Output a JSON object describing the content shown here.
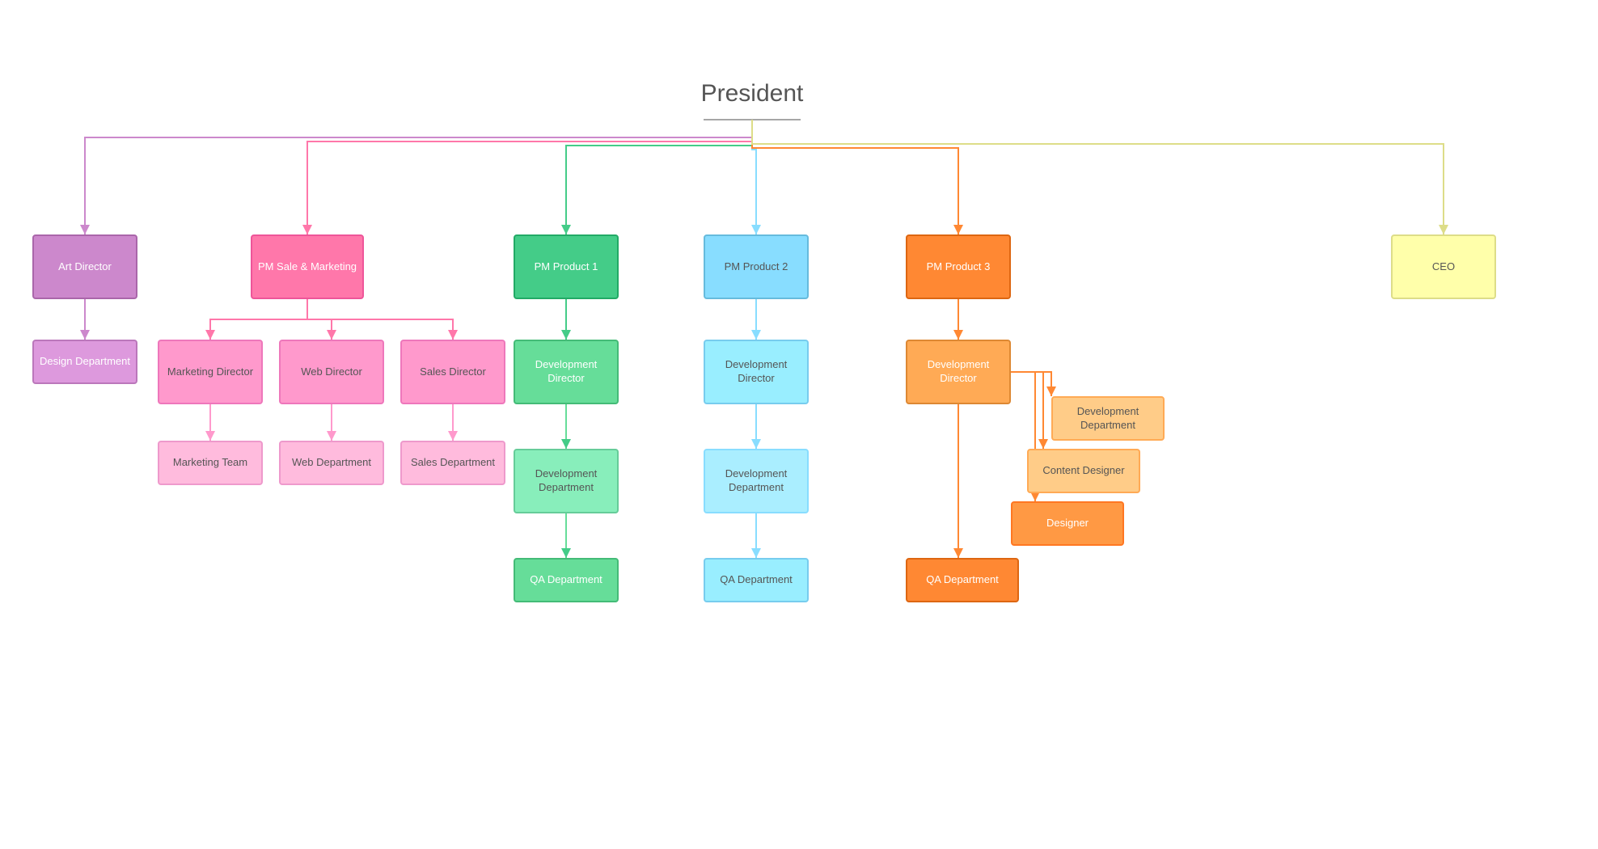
{
  "nodes": {
    "president": "President",
    "art_director": "Art Director",
    "design_dept": "Design Department",
    "pm_sale_marketing": "PM Sale &\nMarketing",
    "marketing_director": "Marketing Director",
    "web_director": "Web Director",
    "sales_director": "Sales Director",
    "marketing_team": "Marketing Team",
    "web_dept": "Web Department",
    "sales_dept": "Sales Department",
    "pm_product1": "PM Product 1",
    "dev_director1": "Development Director",
    "dev_dept1": "Development Department",
    "qa_dept1": "QA Department",
    "pm_product2": "PM Product 2",
    "dev_director2": "Development Director",
    "dev_dept2": "Development Department",
    "qa_dept2": "QA Department",
    "pm_product3": "PM Product 3",
    "dev_director3": "Development Director",
    "dev_dept3": "Development Department",
    "content_designer": "Content Designer",
    "designer": "Designer",
    "qa_dept3": "QA Department",
    "ceo": "CEO"
  },
  "colors": {
    "purple": "#cc88cc",
    "pink": "#ff77aa",
    "pink_light": "#ff99cc",
    "green": "#44cc88",
    "lightblue": "#88ddff",
    "orange": "#ff8833",
    "yellow": "#ffffaa"
  }
}
